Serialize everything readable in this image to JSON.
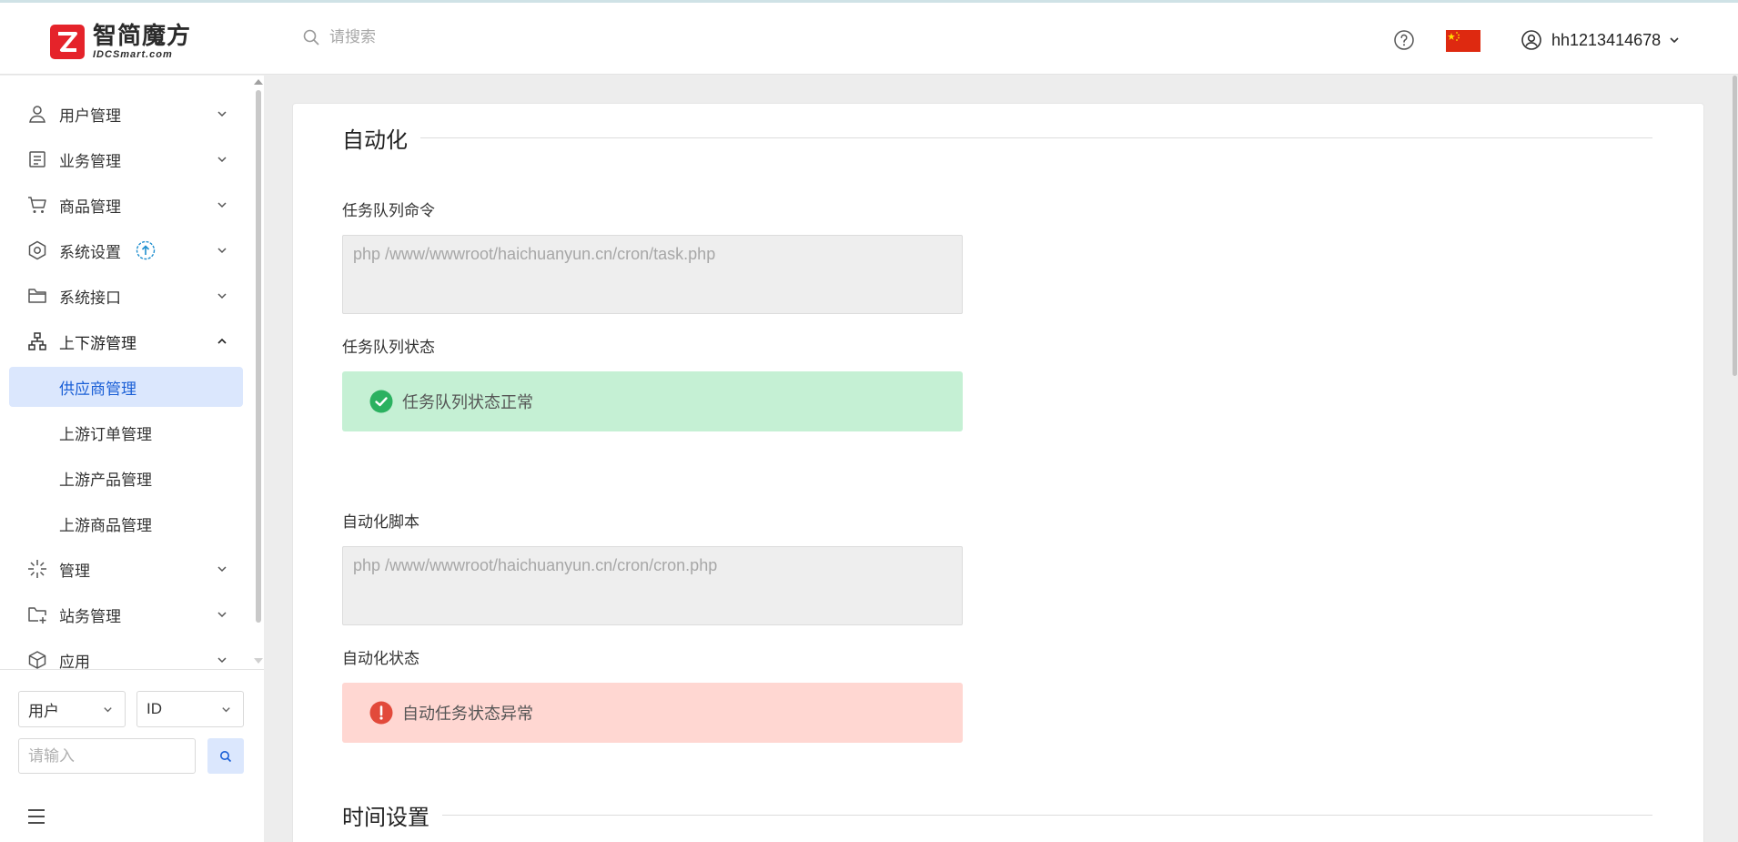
{
  "app": {
    "logo_cn": "智简魔方",
    "logo_en": "IDCSmart.com",
    "search_placeholder": "请搜索",
    "username": "hh1213414678",
    "brand_color": "#e5232a",
    "accent_color": "#1a5fd6"
  },
  "sidebar": {
    "items": [
      {
        "label": "用户管理",
        "icon": "user-icon",
        "expanded": false
      },
      {
        "label": "业务管理",
        "icon": "document-icon",
        "expanded": false
      },
      {
        "label": "商品管理",
        "icon": "cart-icon",
        "expanded": false
      },
      {
        "label": "系统设置",
        "icon": "hexagon-settings-icon",
        "expanded": false,
        "badge_icon": "upgrade-icon"
      },
      {
        "label": "系统接口",
        "icon": "folder-icon",
        "expanded": false
      },
      {
        "label": "上下游管理",
        "icon": "network-icon",
        "expanded": true
      },
      {
        "label": "供应商管理",
        "sub": true,
        "active": true
      },
      {
        "label": "上游订单管理",
        "sub": true
      },
      {
        "label": "上游产品管理",
        "sub": true
      },
      {
        "label": "上游商品管理",
        "sub": true
      },
      {
        "label": "管理",
        "icon": "sparkle-icon",
        "expanded": false
      },
      {
        "label": "站务管理",
        "icon": "folder-plus-icon",
        "expanded": false
      },
      {
        "label": "应用",
        "icon": "cube-icon",
        "expanded": false
      }
    ],
    "filter_type": "用户",
    "filter_field": "ID",
    "filter_placeholder": "请输入"
  },
  "main": {
    "section_automation": "自动化",
    "task_queue_cmd_label": "任务队列命令",
    "task_queue_cmd": "php /www/wwwroot/haichuanyun.cn/cron/task.php",
    "task_queue_status_label": "任务队列状态",
    "task_queue_status": "任务队列状态正常",
    "auto_script_label": "自动化脚本",
    "auto_script_cmd": "php /www/wwwroot/haichuanyun.cn/cron/cron.php",
    "auto_status_label": "自动化状态",
    "auto_status": "自动任务状态异常",
    "section_time": "时间设置",
    "ok_color": "#2bb160",
    "err_color": "#e24a3b"
  }
}
